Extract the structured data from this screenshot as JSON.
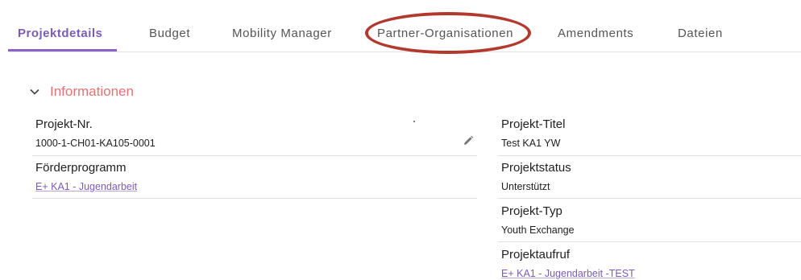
{
  "tabs": [
    {
      "label": "Projektdetails",
      "active": true
    },
    {
      "label": "Budget"
    },
    {
      "label": "Mobility Manager"
    },
    {
      "label": "Partner-Organisationen"
    },
    {
      "label": "Amendments"
    },
    {
      "label": "Dateien"
    }
  ],
  "section": {
    "title": "Informationen",
    "expanded": true,
    "icon": "chevron-down-icon"
  },
  "fields": {
    "projekt_nr": {
      "label": "Projekt-Nr.",
      "value": "1000-1-CH01-KA105-0001"
    },
    "foerderprogramm": {
      "label": "Förderprogramm",
      "value": "E+ KA1 - Jugendarbeit"
    },
    "projekt_titel": {
      "label": "Projekt-Titel",
      "value": "Test KA1 YW"
    },
    "projektstatus": {
      "label": "Projektstatus",
      "value": "Unterstützt"
    },
    "projekt_typ": {
      "label": "Projekt-Typ",
      "value": "Youth Exchange"
    },
    "projektaufruf": {
      "label": "Projektaufruf",
      "value": "E+ KA1 - Jugendarbeit -TEST"
    }
  },
  "colors": {
    "accent": "#8a63c8",
    "section_title": "#e57373",
    "annotation_circle": "#b3392e"
  }
}
